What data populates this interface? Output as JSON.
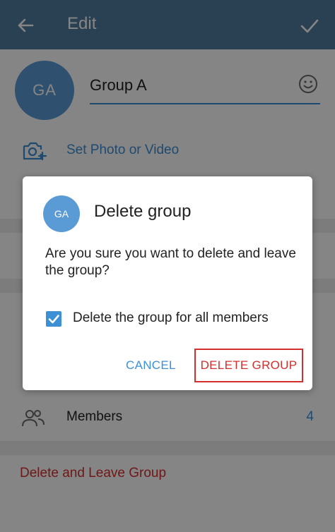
{
  "appbar": {
    "title": "Edit",
    "back_icon": "arrow-left-icon",
    "done_icon": "check-icon",
    "color": "#517da2"
  },
  "group": {
    "avatar_initials": "GA",
    "name": "Group A",
    "emoji_icon": "smile-icon",
    "set_photo_label": "Set Photo or Video",
    "camera_icon": "camera-plus-icon"
  },
  "members": {
    "label": "Members",
    "count": "4",
    "icon": "people-icon"
  },
  "leave_label": "Delete and Leave Group",
  "dialog": {
    "avatar_initials": "GA",
    "title": "Delete group",
    "message": "Are you sure you want to delete and leave the group?",
    "checkbox_label": "Delete the group for all members",
    "checkbox_checked": true,
    "cancel_label": "CANCEL",
    "delete_label": "DELETE GROUP"
  },
  "colors": {
    "accent": "#3d8fd6",
    "danger": "#d32f2f",
    "avatar": "#5b9bd5"
  }
}
